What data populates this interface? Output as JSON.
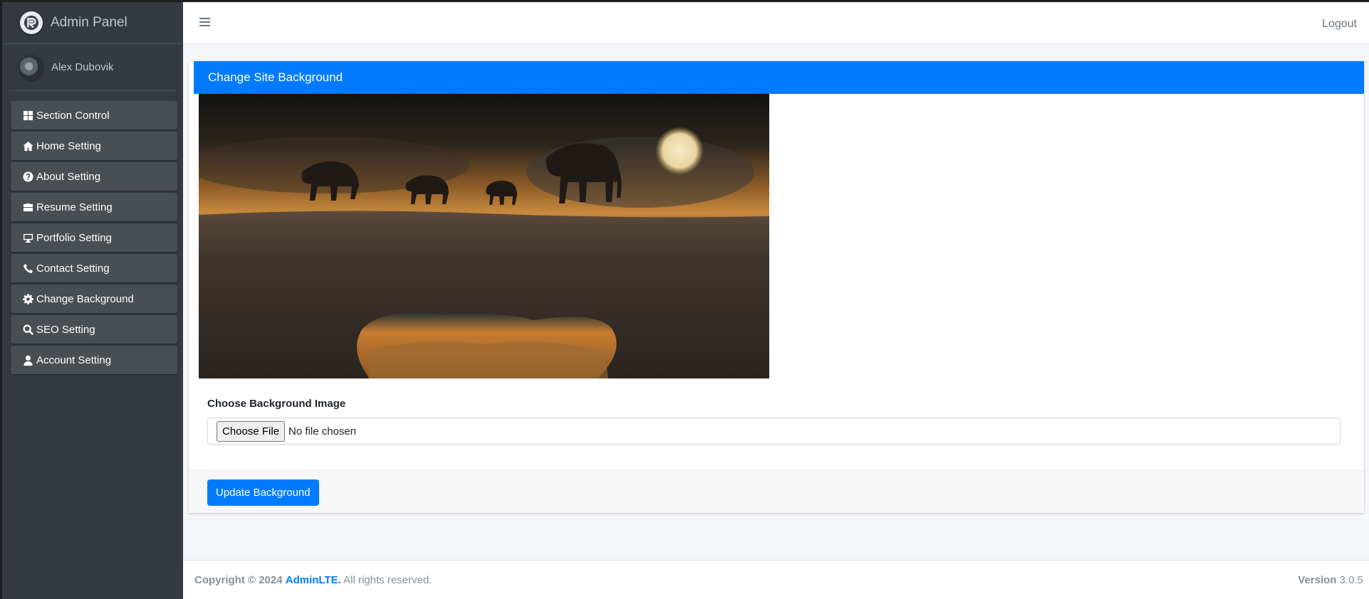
{
  "brand": {
    "title": "Admin Panel"
  },
  "user": {
    "name": "Alex Dubovik"
  },
  "sidebar": {
    "items": [
      {
        "label": "Section Control",
        "icon": "th-large-icon"
      },
      {
        "label": "Home Setting",
        "icon": "home-icon"
      },
      {
        "label": "About Setting",
        "icon": "question-circle-icon"
      },
      {
        "label": "Resume Setting",
        "icon": "briefcase-icon"
      },
      {
        "label": "Portfolio Setting",
        "icon": "desktop-icon"
      },
      {
        "label": "Contact Setting",
        "icon": "phone-icon"
      },
      {
        "label": "Change Background",
        "icon": "gear-icon"
      },
      {
        "label": "SEO Setting",
        "icon": "search-icon"
      },
      {
        "label": "Account Setting",
        "icon": "user-icon"
      }
    ]
  },
  "topbar": {
    "logout_label": "Logout"
  },
  "card": {
    "title": "Change Site Background",
    "field_label": "Choose Background Image",
    "file_button": "Choose File",
    "file_status": "No file chosen",
    "submit_label": "Update Background"
  },
  "footer": {
    "copyright_prefix": "Copyright © 2024",
    "brand_link": "AdminLTE.",
    "rights": "All rights reserved.",
    "version_label": "Version",
    "version_value": "3.0.5"
  },
  "colors": {
    "primary": "#007bff",
    "sidebar_bg": "#343a40",
    "sidebar_item_bg": "#494e53"
  }
}
